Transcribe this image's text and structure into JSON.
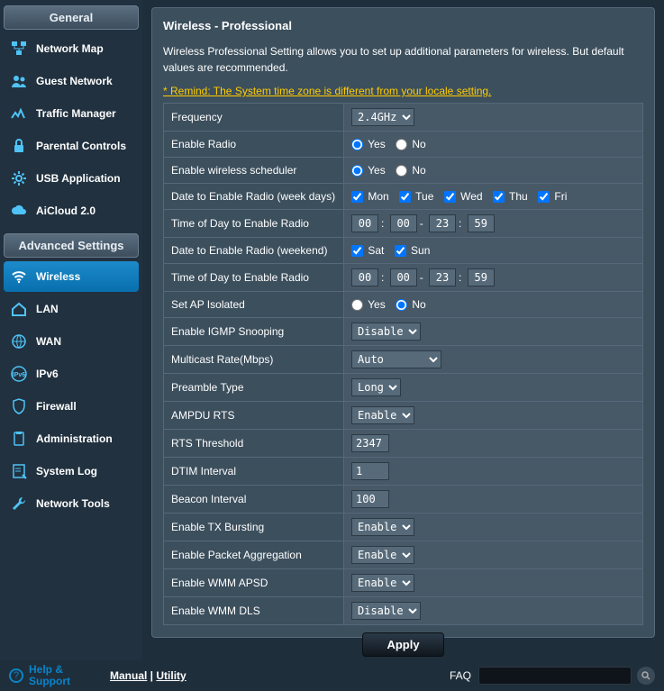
{
  "sidebar": {
    "generalHeader": "General",
    "advancedHeader": "Advanced Settings",
    "general": [
      {
        "label": "Network Map",
        "icon": "network-map-icon"
      },
      {
        "label": "Guest Network",
        "icon": "guest-network-icon"
      },
      {
        "label": "Traffic Manager",
        "icon": "traffic-icon"
      },
      {
        "label": "Parental Controls",
        "icon": "lock-icon"
      },
      {
        "label": "USB Application",
        "icon": "gear-icon"
      },
      {
        "label": "AiCloud 2.0",
        "icon": "cloud-icon"
      }
    ],
    "advanced": [
      {
        "label": "Wireless",
        "icon": "wifi-icon",
        "active": true
      },
      {
        "label": "LAN",
        "icon": "home-icon"
      },
      {
        "label": "WAN",
        "icon": "globe-icon"
      },
      {
        "label": "IPv6",
        "icon": "ipv6-icon"
      },
      {
        "label": "Firewall",
        "icon": "shield-icon"
      },
      {
        "label": "Administration",
        "icon": "clipboard-icon"
      },
      {
        "label": "System Log",
        "icon": "log-icon"
      },
      {
        "label": "Network Tools",
        "icon": "wrench-icon"
      }
    ]
  },
  "page": {
    "title": "Wireless - Professional",
    "description": "Wireless Professional Setting allows you to set up additional parameters for wireless. But default values are recommended.",
    "warning": "* Remind: The System time zone is different from your locale setting."
  },
  "fields": {
    "frequency": {
      "label": "Frequency",
      "value": "2.4GHz"
    },
    "enableRadio": {
      "label": "Enable Radio",
      "yes": "Yes",
      "no": "No",
      "value": "Yes"
    },
    "enableScheduler": {
      "label": "Enable wireless scheduler",
      "yes": "Yes",
      "no": "No",
      "value": "Yes"
    },
    "weekdays": {
      "label": "Date to Enable Radio (week days)",
      "mon": "Mon",
      "tue": "Tue",
      "wed": "Wed",
      "thu": "Thu",
      "fri": "Fri"
    },
    "weekTime": {
      "label": "Time of Day to Enable Radio",
      "h1": "00",
      "m1": "00",
      "h2": "23",
      "m2": "59"
    },
    "weekend": {
      "label": "Date to Enable Radio (weekend)",
      "sat": "Sat",
      "sun": "Sun"
    },
    "weekendTime": {
      "label": "Time of Day to Enable Radio",
      "h1": "00",
      "m1": "00",
      "h2": "23",
      "m2": "59"
    },
    "apIsolated": {
      "label": "Set AP Isolated",
      "yes": "Yes",
      "no": "No",
      "value": "No"
    },
    "igmp": {
      "label": "Enable IGMP Snooping",
      "value": "Disable"
    },
    "multicast": {
      "label": "Multicast Rate(Mbps)",
      "value": "Auto"
    },
    "preamble": {
      "label": "Preamble Type",
      "value": "Long"
    },
    "ampdu": {
      "label": "AMPDU RTS",
      "value": "Enable"
    },
    "rts": {
      "label": "RTS Threshold",
      "value": "2347"
    },
    "dtim": {
      "label": "DTIM Interval",
      "value": "1"
    },
    "beacon": {
      "label": "Beacon Interval",
      "value": "100"
    },
    "txburst": {
      "label": "Enable TX Bursting",
      "value": "Enable"
    },
    "pktagg": {
      "label": "Enable Packet Aggregation",
      "value": "Enable"
    },
    "wmmapsd": {
      "label": "Enable WMM APSD",
      "value": "Enable"
    },
    "wmmdls": {
      "label": "Enable WMM DLS",
      "value": "Disable"
    }
  },
  "apply": "Apply",
  "footer": {
    "help": "Help & Support",
    "manual": "Manual",
    "utility": "Utility",
    "faq": "FAQ"
  }
}
